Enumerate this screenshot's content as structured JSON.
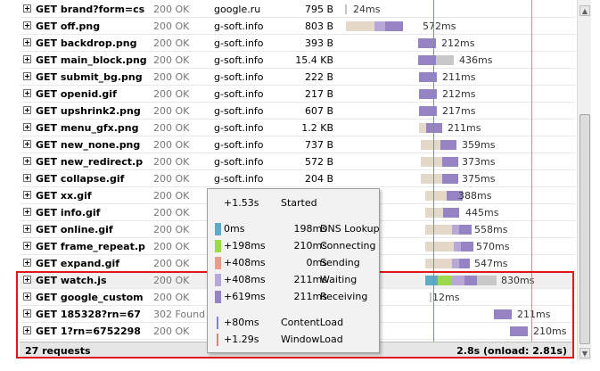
{
  "colors": {
    "blocking": "#e4d8c8",
    "dns": "#61aac6",
    "connect": "#9cd84c",
    "send": "#e89e8e",
    "wait": "#b8a8d8",
    "receive": "#9583c4",
    "content_load_line": "#8080e0",
    "window_load_line": "#e08080",
    "selection_outline": "#e01818"
  },
  "requests": [
    {
      "url": "GET brand?form=cs",
      "status": "200 OK",
      "domain": "google.ru",
      "size": "795 B",
      "time": "24ms"
    },
    {
      "url": "GET off.png",
      "status": "200 OK",
      "domain": "g-soft.info",
      "size": "803 B",
      "time": "572ms"
    },
    {
      "url": "GET backdrop.png",
      "status": "200 OK",
      "domain": "g-soft.info",
      "size": "393 B",
      "time": "212ms"
    },
    {
      "url": "GET main_block.png",
      "status": "200 OK",
      "domain": "g-soft.info",
      "size": "15.4 KB",
      "time": "436ms"
    },
    {
      "url": "GET submit_bg.png",
      "status": "200 OK",
      "domain": "g-soft.info",
      "size": "222 B",
      "time": "211ms"
    },
    {
      "url": "GET openid.gif",
      "status": "200 OK",
      "domain": "g-soft.info",
      "size": "217 B",
      "time": "212ms"
    },
    {
      "url": "GET upshrink2.png",
      "status": "200 OK",
      "domain": "g-soft.info",
      "size": "607 B",
      "time": "217ms"
    },
    {
      "url": "GET menu_gfx.png",
      "status": "200 OK",
      "domain": "g-soft.info",
      "size": "1.2 KB",
      "time": "211ms"
    },
    {
      "url": "GET new_none.png",
      "status": "200 OK",
      "domain": "g-soft.info",
      "size": "737 B",
      "time": "359ms"
    },
    {
      "url": "GET new_redirect.p",
      "status": "200 OK",
      "domain": "g-soft.info",
      "size": "572 B",
      "time": "373ms"
    },
    {
      "url": "GET collapse.gif",
      "status": "200 OK",
      "domain": "g-soft.info",
      "size": "204 B",
      "time": "375ms"
    },
    {
      "url": "GET xx.gif",
      "status": "200 OK",
      "domain": "g-s",
      "size": "",
      "time": "388ms"
    },
    {
      "url": "GET info.gif",
      "status": "200 OK",
      "domain": "g-s",
      "size": "",
      "time": "445ms"
    },
    {
      "url": "GET online.gif",
      "status": "200 OK",
      "domain": "g-s",
      "size": "",
      "time": "558ms"
    },
    {
      "url": "GET frame_repeat.p",
      "status": "200 OK",
      "domain": "g-s",
      "size": "",
      "time": "570ms"
    },
    {
      "url": "GET expand.gif",
      "status": "200 OK",
      "domain": "g-s",
      "size": "",
      "time": "547ms"
    },
    {
      "url": "GET watch.js",
      "status": "200 OK",
      "domain": "mc",
      "size": "",
      "time": "830ms"
    },
    {
      "url": "GET google_custom",
      "status": "200 OK",
      "domain": "mc",
      "size": "",
      "time": "12ms"
    },
    {
      "url": "GET 185328?rn=67",
      "status": "302 Found",
      "domain": "mc",
      "size": "",
      "time": "211ms"
    },
    {
      "url": "GET 1?rn=6752298",
      "status": "200 OK",
      "domain": "mc",
      "size": "",
      "time": "210ms"
    }
  ],
  "footer": {
    "count": "27 requests",
    "total": "2.8s (onload: 2.81s)"
  },
  "tooltip": {
    "started": {
      "offset": "+1.53s",
      "label": "Started"
    },
    "phases": [
      {
        "offset": "0ms",
        "duration": "198ms",
        "label": "DNS Lookup",
        "color": "#61aac6"
      },
      {
        "offset": "+198ms",
        "duration": "210ms",
        "label": "Connecting",
        "color": "#9cd84c"
      },
      {
        "offset": "+408ms",
        "duration": "0ms",
        "label": "Sending",
        "color": "#e89e8e"
      },
      {
        "offset": "+408ms",
        "duration": "211ms",
        "label": "Waiting",
        "color": "#b8a8d8"
      },
      {
        "offset": "+619ms",
        "duration": "211ms",
        "label": "Receiving",
        "color": "#9583c4"
      }
    ],
    "events": [
      {
        "offset": "+80ms",
        "label": "ContentLoad",
        "color": "#8080e0"
      },
      {
        "offset": "+1.29s",
        "label": "WindowLoad",
        "color": "#e08080"
      }
    ]
  }
}
